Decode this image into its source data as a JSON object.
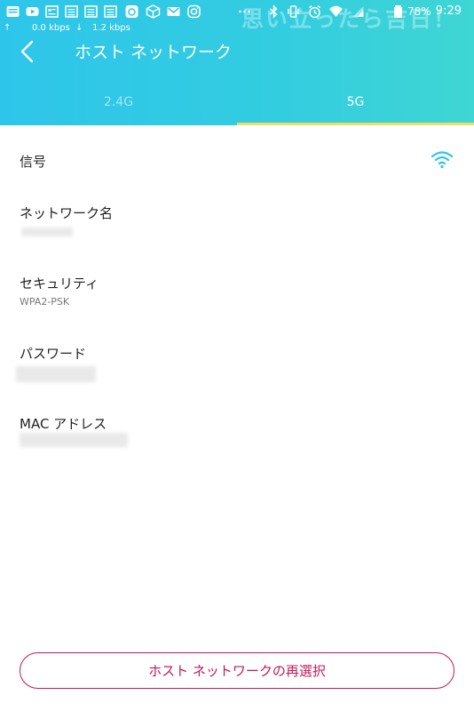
{
  "status_bar": {
    "time": "9:29",
    "battery_percent": "78%",
    "upload_speed": "0.0 kbps",
    "download_speed": "1.2 kbps",
    "watermark": "思い立ったら吉日！",
    "icons": [
      "news-icon",
      "youtube-icon",
      "news-icon",
      "news-icon",
      "news-icon",
      "camera-icon",
      "box-icon",
      "mail-icon",
      "instagram-icon",
      "more-icon",
      "bluetooth-icon",
      "vibrate-icon",
      "alarm-icon",
      "wifi-icon",
      "signal-icon",
      "battery-icon"
    ]
  },
  "header": {
    "title": "ホスト ネットワーク",
    "back_icon": "chevron-left-icon"
  },
  "tabs": [
    {
      "label": "2.4G",
      "selected": false
    },
    {
      "label": "5G",
      "selected": true
    }
  ],
  "rows": {
    "signal": {
      "label": "信号",
      "icon": "wifi-signal-icon"
    },
    "network_name": {
      "label": "ネットワーク名"
    },
    "security": {
      "label": "セキュリティ",
      "value": "WPA2-PSK"
    },
    "password": {
      "label": "パスワード"
    },
    "mac_address": {
      "label": "MAC アドレス"
    }
  },
  "reselect_button": {
    "label": "ホスト ネットワークの再選択"
  },
  "colors": {
    "header_start": "#2ec5ea",
    "header_end": "#3fd6d3",
    "tab_indicator": "#f1dc6a",
    "accent": "#c2185b"
  }
}
